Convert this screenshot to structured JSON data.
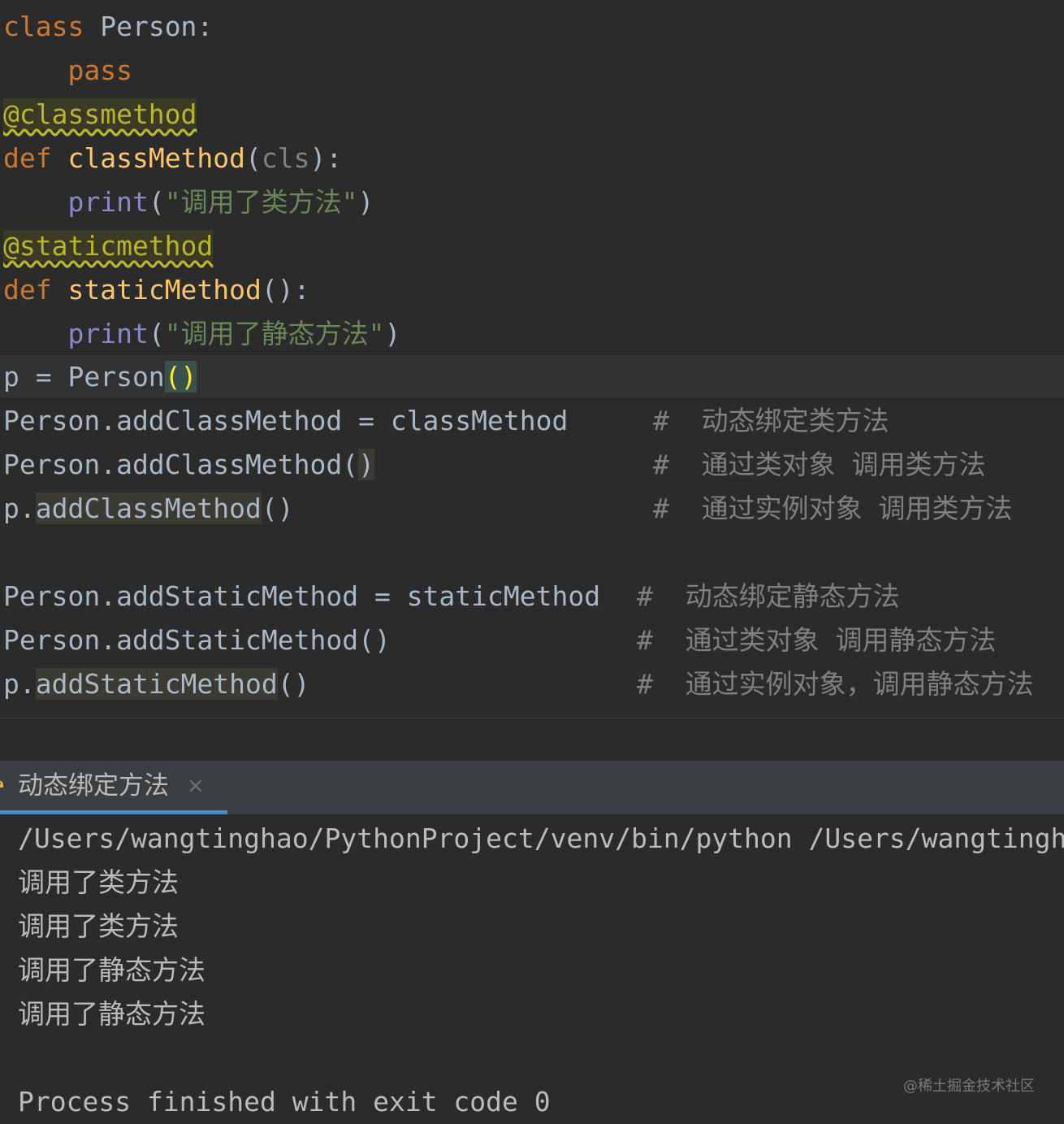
{
  "editor": {
    "line1": {
      "kw": "class",
      "name": "Person",
      "colon": ":"
    },
    "line2": {
      "kw": "pass"
    },
    "line3": {
      "decorator": "@classmethod"
    },
    "line4": {
      "kw": "def",
      "fn": "classMethod",
      "open": "(",
      "param": "cls",
      "close": "):"
    },
    "line5": {
      "builtin": "print",
      "open": "(",
      "str": "\"调用了类方法\"",
      "close": ")"
    },
    "line6": {
      "decorator": "@staticmethod"
    },
    "line7": {
      "kw": "def",
      "fn": "staticMethod",
      "parens": "():"
    },
    "line8": {
      "builtin": "print",
      "open": "(",
      "str": "\"调用了静态方法\"",
      "close": ")"
    },
    "line9": {
      "lhs": "p = Person",
      "parens": "()"
    },
    "line10": {
      "code": "Person.addClassMethod = classMethod",
      "comment": "#  动态绑定类方法"
    },
    "line11": {
      "code": "Person.addClassMethod(",
      "close": ")",
      "comment": "#  通过类对象 调用类方法"
    },
    "line12": {
      "prefix": "p.",
      "attr": "addClassMethod",
      "parens": "()",
      "comment": "#  通过实例对象 调用类方法"
    },
    "line14": {
      "code": "Person.addStaticMethod = staticMethod",
      "comment": "#  动态绑定静态方法"
    },
    "line15": {
      "code": "Person.addStaticMethod()",
      "comment": "#  通过类对象 调用静态方法"
    },
    "line16": {
      "prefix": "p.",
      "attr": "addStaticMethod",
      "parens": "()",
      "comment": "#  通过实例对象，调用静态方法"
    }
  },
  "run_panel": {
    "tab_label": "动态绑定方法",
    "close_glyph": "×",
    "icon": "python-icon"
  },
  "console": {
    "command": "/Users/wangtinghao/PythonProject/venv/bin/python /Users/wangtingh",
    "output": [
      "调用了类方法",
      "调用了类方法",
      "调用了静态方法",
      "调用了静态方法"
    ],
    "exit_message": "Process finished with exit code 0"
  },
  "watermark": "@稀土掘金技术社区",
  "colors": {
    "background": "#2b2b2b",
    "keyword": "#cc7832",
    "function": "#ffc66d",
    "builtin": "#8888c6",
    "string": "#6a8759",
    "comment": "#808080",
    "decorator": "#bbb529",
    "tab_accent": "#4a88c7"
  }
}
